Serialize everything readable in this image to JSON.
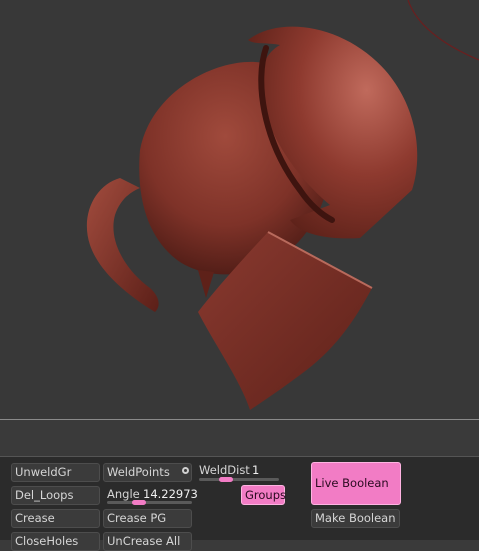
{
  "viewport": {
    "mesh_color": "#8a3a30",
    "background": "#383838"
  },
  "panel": {
    "col1": {
      "unweld": "UnweldGr",
      "del_loops": "Del_Loops",
      "crease": "Crease",
      "close_holes": "CloseHoles"
    },
    "col2": {
      "weld_points": "WeldPoints",
      "angle_label": "Angle",
      "angle_value": "14.22973",
      "angle_level": 0.35,
      "crease_pg": "Crease PG",
      "uncrease_all": "UnCrease All"
    },
    "col3": {
      "weld_dist_label": "WeldDist",
      "weld_dist_value": "1",
      "weld_dist_level": 0.3,
      "groups": "Groups"
    },
    "col4": {
      "live_boolean": "Live Boolean",
      "make_boolean": "Make Boolean"
    },
    "accent": "#f27cc5"
  }
}
